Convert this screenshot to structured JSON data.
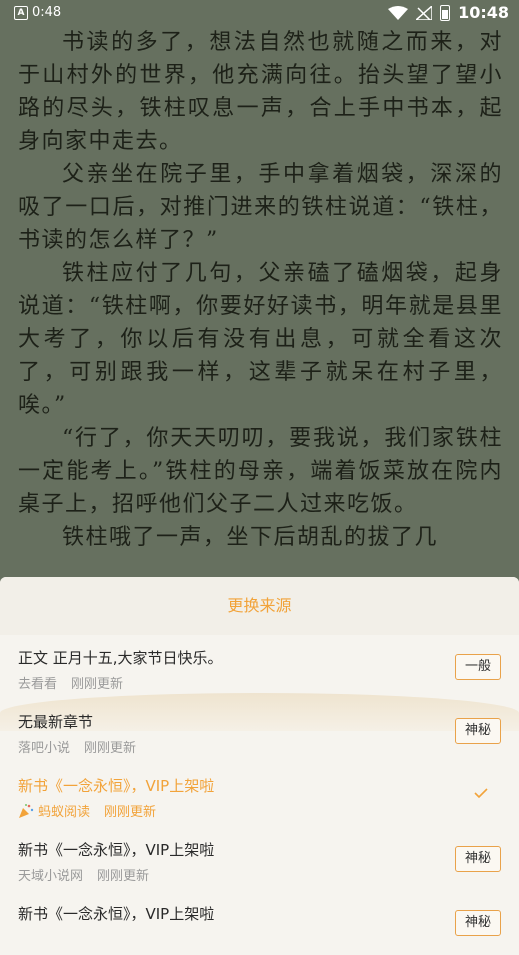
{
  "status_bar": {
    "small_time": "0:48",
    "big_time": "10:48"
  },
  "reader": {
    "paragraphs": [
      "书读的多了，想法自然也就随之而来，对于山村外的世界，他充满向往。抬头望了望小路的尽头，铁柱叹息一声，合上手中书本，起身向家中走去。",
      "父亲坐在院子里，手中拿着烟袋，深深的吸了一口后，对推门进来的铁柱说道：“铁柱，书读的怎么样了？”",
      "铁柱应付了几句，父亲磕了磕烟袋，起身说道：“铁柱啊，你要好好读书，明年就是县里大考了，你以后有没有出息，可就全看这次了，可别跟我一样，这辈子就呆在村子里，唉。”",
      "“行了，你天天叨叨，要我说，我们家铁柱一定能考上。”铁柱的母亲，端着饭菜放在院内桌子上，招呼他们父子二人过来吃饭。",
      "铁柱哦了一声，坐下后胡乱的拔了几"
    ]
  },
  "sheet": {
    "title": "更换来源",
    "items": [
      {
        "title": "正文 正月十五,大家节日快乐。",
        "source": "去看看",
        "updated": "刚刚更新",
        "tag": "一般"
      },
      {
        "title": "无最新章节",
        "source": "落吧小说",
        "updated": "刚刚更新",
        "tag": "神秘"
      },
      {
        "title": "新书《一念永恒》，VIP上架啦",
        "source": "蚂蚁阅读",
        "updated": "刚刚更新",
        "tag": ""
      },
      {
        "title": "新书《一念永恒》，VIP上架啦",
        "source": "天域小说网",
        "updated": "刚刚更新",
        "tag": "神秘"
      },
      {
        "title": "新书《一念永恒》，VIP上架啦",
        "source": "",
        "updated": "",
        "tag": "神秘"
      }
    ]
  },
  "colors": {
    "accent": "#f2a33a",
    "reader_bg": "#66705f",
    "sheet_bg": "#f4f1ea"
  }
}
